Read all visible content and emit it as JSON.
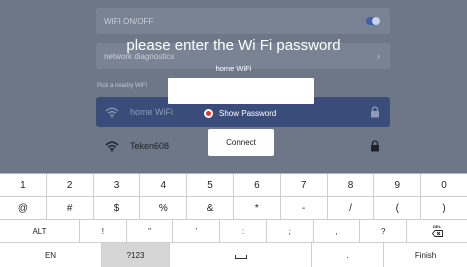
{
  "background": {
    "wifi_toggle_label": "WIFI ON/OFF",
    "network_diagnostics_label": "network diagnostics",
    "section_label": "Pick a nearby WiFi",
    "networks": [
      {
        "name": "home WiFi",
        "icon": "wifi-icon",
        "locked": true
      },
      {
        "name": "Teken608",
        "icon": "wifi-icon",
        "locked": true
      }
    ],
    "colors": {
      "accent": "#3f5fa8",
      "selected_row": "#3a4c7a"
    }
  },
  "dialog": {
    "title": "please enter the Wi Fi password",
    "network_name": "home WiFi",
    "password_value": "",
    "show_password_label": "Show Password",
    "connect_label": "Connect",
    "colors": {
      "radio_selected": "#e0392d"
    }
  },
  "keyboard": {
    "row1": [
      "1",
      "2",
      "3",
      "4",
      "5",
      "6",
      "7",
      "8",
      "9",
      "0"
    ],
    "row2": [
      "@",
      "#",
      "$",
      "%",
      "&",
      "*",
      "-",
      "/",
      "(",
      ")"
    ],
    "row3": {
      "alt": "ALT",
      "symbols": [
        "!",
        "\"",
        "'",
        ":",
        ";",
        ",",
        "?"
      ],
      "delete_label": "DEL"
    },
    "row4": {
      "language": "EN",
      "numbers": "?123",
      "period": ".",
      "finish": "Finish"
    }
  }
}
